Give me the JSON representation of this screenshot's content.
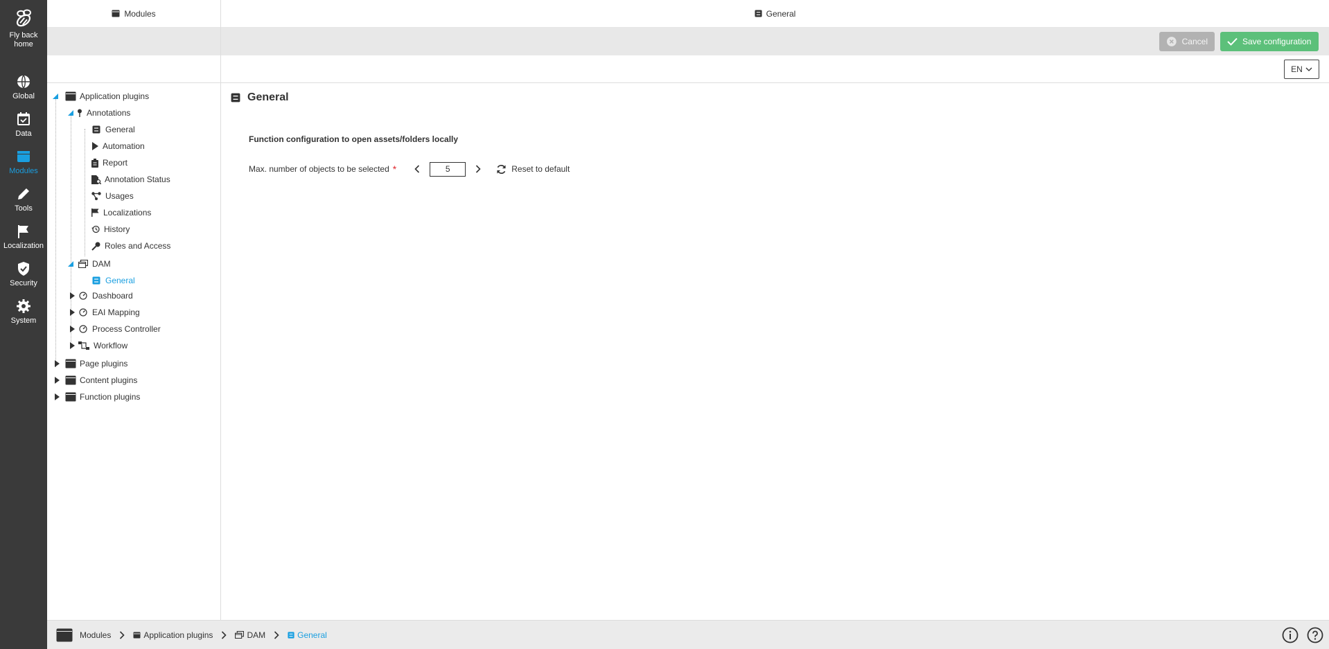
{
  "rail": {
    "items": [
      {
        "label_line1": "Fly back",
        "label_line2": "home",
        "icon": "bee-icon"
      },
      {
        "label": "Global",
        "icon": "globe-icon"
      },
      {
        "label": "Data",
        "icon": "calendar-check-icon"
      },
      {
        "label": "Modules",
        "icon": "window-icon",
        "active": true
      },
      {
        "label": "Tools",
        "icon": "pencil-icon"
      },
      {
        "label": "Localization",
        "icon": "flag-icon"
      },
      {
        "label": "Security",
        "icon": "shield-icon"
      },
      {
        "label": "System",
        "icon": "gear-icon"
      }
    ],
    "active_color": "#1a9fe0"
  },
  "left_panel": {
    "title": "Modules"
  },
  "right_panel": {
    "title": "General"
  },
  "toolbar": {
    "cancel_label": "Cancel",
    "save_label": "Save configuration",
    "language": "EN"
  },
  "tree": {
    "application_plugins": "Application plugins",
    "annotations": "Annotations",
    "annotations_children": [
      "General",
      "Automation",
      "Report",
      "Annotation Status",
      "Usages",
      "Localizations",
      "History",
      "Roles and Access"
    ],
    "dam": "DAM",
    "dam_children": [
      "General"
    ],
    "dashboard": "Dashboard",
    "eai_mapping": "EAI Mapping",
    "process_controller": "Process Controller",
    "workflow": "Workflow",
    "page_plugins": "Page plugins",
    "content_plugins": "Content plugins",
    "function_plugins": "Function plugins"
  },
  "content": {
    "title": "General",
    "section_heading": "Function configuration to open assets/folders locally",
    "field_label": "Max. number of objects to be selected",
    "required_marker": "*",
    "field_value": "5",
    "reset_label": "Reset to default"
  },
  "breadcrumb": [
    "Modules",
    "Application plugins",
    "DAM",
    "General"
  ],
  "colors": {
    "accent": "#1a9fe0",
    "save": "#5cc07a",
    "cancel": "#b2b2b2",
    "rail_bg": "#3a3a3a"
  }
}
